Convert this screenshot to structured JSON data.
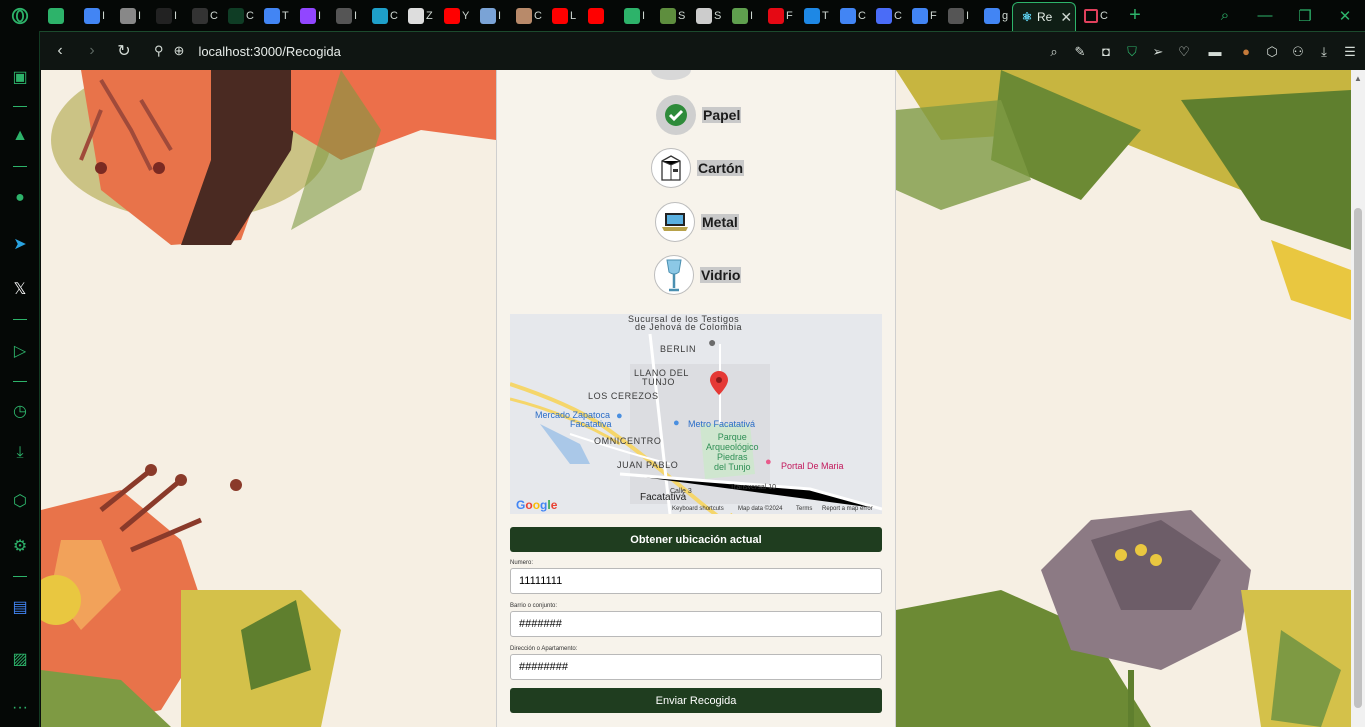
{
  "browser": {
    "tabs": [
      {
        "icon": "gamepad-icon",
        "char": "",
        "color": "#2db36a"
      },
      {
        "icon": "google-icon",
        "char": "I",
        "color": "#4285f4"
      },
      {
        "icon": "chrome-icon",
        "char": "I",
        "color": "#888"
      },
      {
        "icon": "github-icon",
        "char": "I",
        "color": "#222"
      },
      {
        "icon": "openai-icon",
        "char": "C",
        "color": "#333"
      },
      {
        "icon": "chatgpt-icon",
        "char": "C",
        "color": "#0f3d25"
      },
      {
        "icon": "translate-icon",
        "char": "T",
        "color": "#4285f4"
      },
      {
        "icon": "twitch-icon",
        "char": "I",
        "color": "#9146ff"
      },
      {
        "icon": "globe-icon",
        "char": "I",
        "color": "#555"
      },
      {
        "icon": "e-icon",
        "char": "C",
        "color": "#1ea0c9"
      },
      {
        "icon": "v-icon",
        "char": "Z",
        "color": "#ddd"
      },
      {
        "icon": "youtube-icon",
        "char": "Y",
        "color": "#ff0000"
      },
      {
        "icon": "image-icon",
        "char": "I",
        "color": "#7aa3d6"
      },
      {
        "icon": "avatar-icon",
        "char": "C",
        "color": "#b88a6a"
      },
      {
        "icon": "youtube-icon",
        "char": "L",
        "color": "#ff0000"
      },
      {
        "icon": "youtube-audio-icon",
        "char": "",
        "color": "#ff0000"
      },
      {
        "icon": "arrow-icon",
        "char": "I",
        "color": "#2db36a"
      },
      {
        "icon": "shopify-icon",
        "char": "S",
        "color": "#5e8e3e"
      },
      {
        "icon": "n-icon",
        "char": "S",
        "color": "#ccc"
      },
      {
        "icon": "node-icon",
        "char": "I",
        "color": "#5fa04e"
      },
      {
        "icon": "netflix-icon",
        "char": "F",
        "color": "#e50914"
      },
      {
        "icon": "terminal-icon",
        "char": "T",
        "color": "#1e88e5"
      },
      {
        "icon": "google-icon",
        "char": "C",
        "color": "#4285f4"
      },
      {
        "icon": "gemini-icon",
        "char": "C",
        "color": "#4a6cf7"
      },
      {
        "icon": "google-icon",
        "char": "F",
        "color": "#4285f4"
      },
      {
        "icon": "globe-icon",
        "char": "I",
        "color": "#555"
      },
      {
        "icon": "google-icon",
        "char": "g",
        "color": "#4285f4"
      }
    ],
    "active_tab": {
      "label": "Re",
      "icon": "react-icon"
    },
    "last_tab": {
      "char": "C",
      "icon": "window-icon"
    },
    "url": "localhost:3000/Recogida"
  },
  "materials": [
    {
      "name": "Papel",
      "icon": "checkmark-icon"
    },
    {
      "name": "Cartón",
      "icon": "carton-icon"
    },
    {
      "name": "Metal",
      "icon": "laptop-icon"
    },
    {
      "name": "Vidrio",
      "icon": "glass-icon"
    }
  ],
  "map": {
    "labels": {
      "sucursal": "Sucursal de los Testigos",
      "sucursal2": "de Jehová de Colombia",
      "berlin": "BERLIN",
      "llano": "LLANO DEL",
      "tunjo": "TUNJO",
      "cerezos": "LOS CEREZOS",
      "mercado": "Mercado Zapatoca",
      "mercado2": "Facatativa",
      "omnicentro": "OMNICENTRO",
      "metro": "Metro Facatativá",
      "parque": "Parque\nArqueológico\nPiedras\ndel Tunjo",
      "portal": "Portal De Maria",
      "juanpablo": "JUAN PABLO",
      "facatativa": "Facatativá",
      "transversal": "Transversal 10",
      "calle": "Calle 3"
    },
    "footer": {
      "google": "Google",
      "shortcuts": "Keyboard shortcuts",
      "data": "Map data ©2024",
      "terms": "Terms",
      "report": "Report a map error"
    }
  },
  "form": {
    "location_button": "Obtener ubicación actual",
    "fields": [
      {
        "label": "Numero:",
        "value": "11111111"
      },
      {
        "label": "Barrio o conjunto:",
        "value": "#######"
      },
      {
        "label": "Dirección o Apartamento:",
        "value": "########"
      }
    ],
    "submit_button": "Enviar Recogida"
  }
}
